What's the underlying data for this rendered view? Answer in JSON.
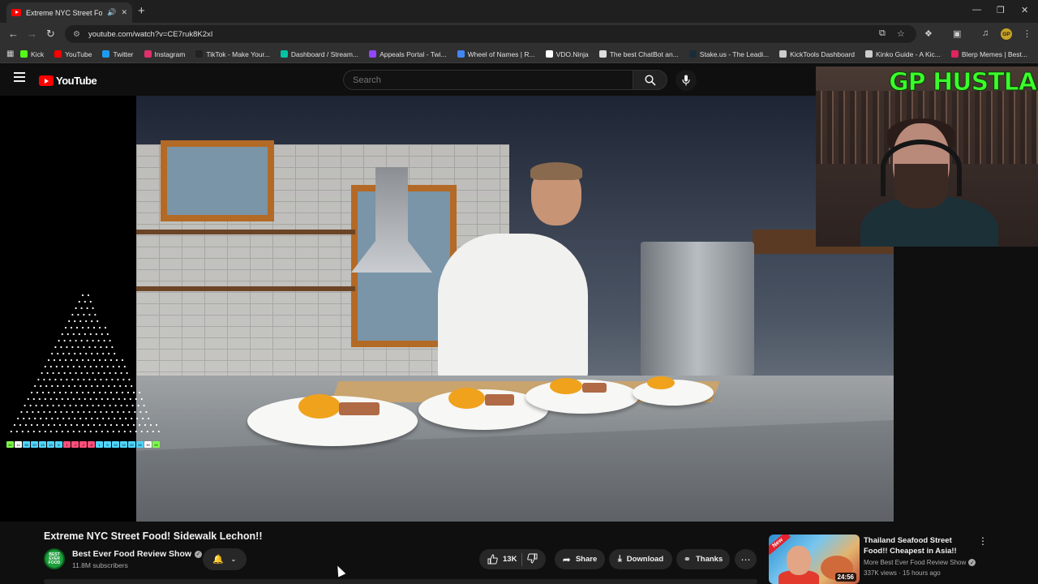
{
  "browser": {
    "tab_title": "Extreme NYC Street Food! S",
    "url": "youtube.com/watch?v=CE7ruk8K2xI",
    "profile_initials": "GP",
    "bookmarks": [
      {
        "label": "Kick",
        "color": "#53fc18"
      },
      {
        "label": "YouTube",
        "color": "#ff0000"
      },
      {
        "label": "Twitter",
        "color": "#1d9bf0"
      },
      {
        "label": "Instagram",
        "color": "#e1306c"
      },
      {
        "label": "TikTok - Make Your...",
        "color": "#222222"
      },
      {
        "label": "Dashboard / Stream...",
        "color": "#00c3a5"
      },
      {
        "label": "Appeals Portal - Twi...",
        "color": "#9146ff"
      },
      {
        "label": "Wheel of Names | R...",
        "color": "#4285f4"
      },
      {
        "label": "VDO.Ninja",
        "color": "#ffffff"
      },
      {
        "label": "The best ChatBot an...",
        "color": "#dddddd"
      },
      {
        "label": "Stake.us - The Leadi...",
        "color": "#1a2c38"
      },
      {
        "label": "KickTools Dashboard",
        "color": "#cccccc"
      },
      {
        "label": "Kinko Guide - A Kic...",
        "color": "#cccccc"
      },
      {
        "label": "Blerp Memes | Best...",
        "color": "#e0245e"
      }
    ]
  },
  "youtube": {
    "logo_text": "YouTube",
    "search_placeholder": "Search",
    "video_title": "Extreme NYC Street Food! Sidewalk Lechon!!",
    "channel_name": "Best Ever Food Review Show",
    "avatar_text": "BEST EVER FOOD",
    "subscribers": "11.8M subscribers",
    "likes": "13K",
    "share_label": "Share",
    "download_label": "Download",
    "thanks_label": "Thanks",
    "recommended": {
      "title": "Thailand Seafood Street Food!! Cheapest in Asia!!",
      "channel": "More Best Ever Food Review Show",
      "meta": "337K views · 15 hours ago",
      "duration": "24:56",
      "badge": "New"
    }
  },
  "overlay": {
    "webcam_brand": "GP HUSTLA",
    "meter_values": [
      "20",
      "10",
      "35",
      "20",
      "15",
      "10",
      "5",
      "1",
      "-1",
      "-2",
      "-5",
      "1",
      "5",
      "10",
      "15",
      "20",
      "25",
      "30",
      "20"
    ],
    "meter_colors": [
      "#7dff4a",
      "#ffffff",
      "#4fd6ff",
      "#4fd6ff",
      "#4fd6ff",
      "#4fd6ff",
      "#4fd6ff",
      "#ff4f7a",
      "#ff4f7a",
      "#ff4f7a",
      "#ff4f7a",
      "#4fd6ff",
      "#4fd6ff",
      "#4fd6ff",
      "#4fd6ff",
      "#4fd6ff",
      "#4fd6ff",
      "#ffffff",
      "#7dff4a"
    ]
  }
}
